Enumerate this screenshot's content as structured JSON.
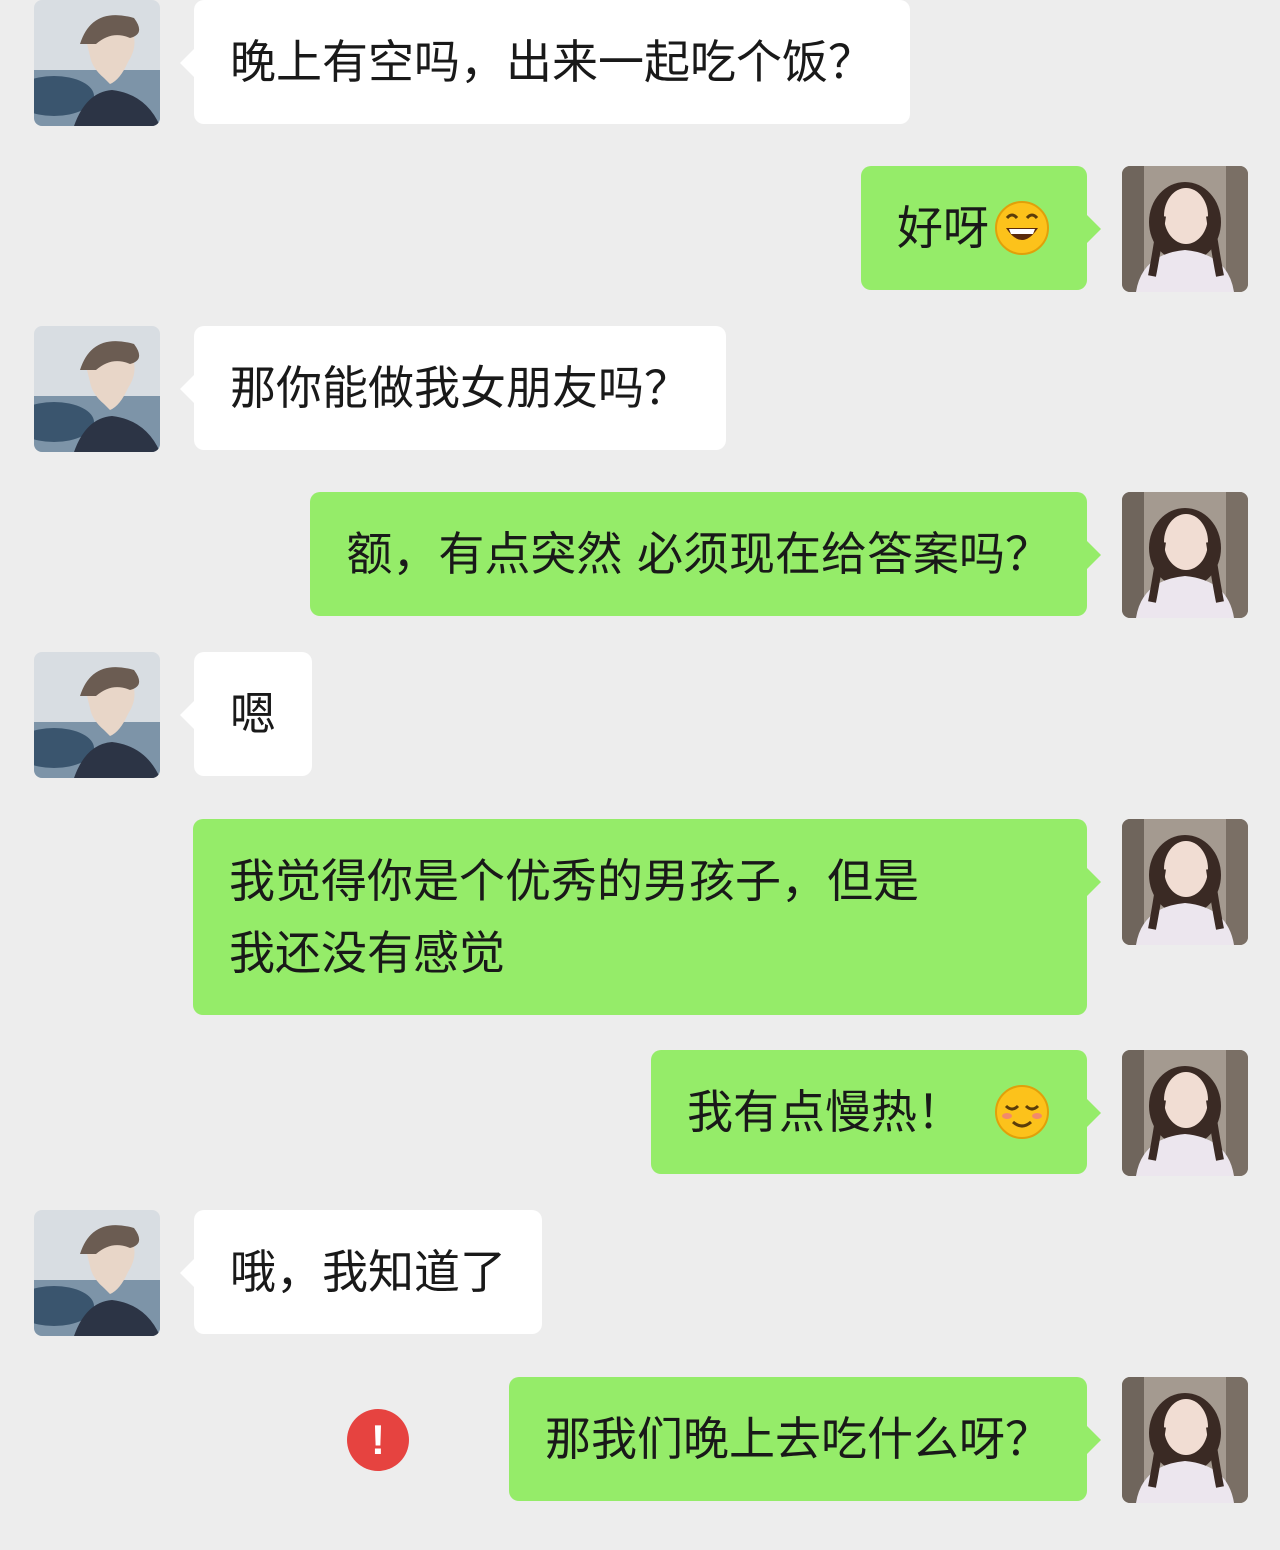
{
  "messages": [
    {
      "sender": "him",
      "text": "晚上有空吗，出来一起吃个饭？"
    },
    {
      "sender": "her",
      "text": "好呀",
      "emoji": "grin-emoji"
    },
    {
      "sender": "him",
      "text": "那你能做我女朋友吗？"
    },
    {
      "sender": "her",
      "text": "额，有点突然 必须现在给答案吗？"
    },
    {
      "sender": "him",
      "text": "嗯"
    },
    {
      "sender": "her",
      "text": "我觉得你是个优秀的男孩子，但是\n我还没有感觉"
    },
    {
      "sender": "her",
      "text": "我有点慢热！",
      "emoji": "shy-smile-emoji"
    },
    {
      "sender": "him",
      "text": "哦，我知道了"
    },
    {
      "sender": "her",
      "text": "那我们晚上去吃什么呀？",
      "status": "send-failed",
      "status_glyph": "!"
    }
  ],
  "colors": {
    "background": "#ededed",
    "incoming_bubble": "#ffffff",
    "outgoing_bubble": "#95ec69",
    "failed_icon": "#e64340"
  }
}
